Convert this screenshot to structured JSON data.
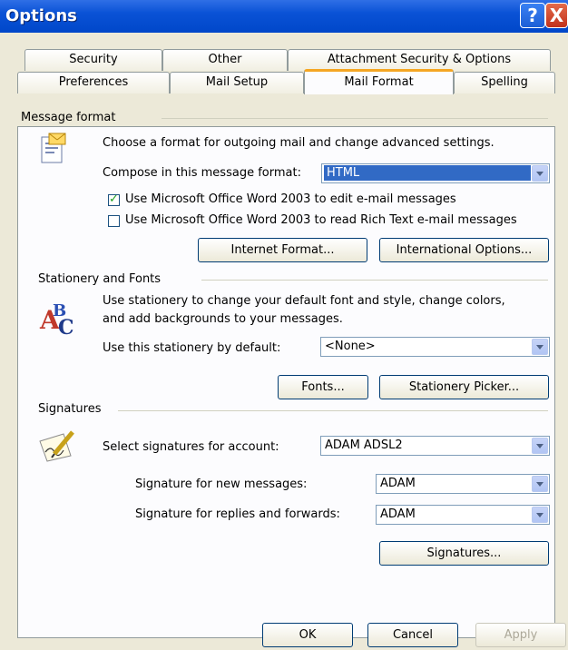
{
  "window": {
    "title": "Options",
    "help_glyph": "?",
    "close_glyph": "X"
  },
  "tabs_row1": [
    "Security",
    "Other",
    "Attachment Security & Options"
  ],
  "tabs_row2": [
    "Preferences",
    "Mail Setup",
    "Mail Format",
    "Spelling"
  ],
  "active_tab": "Mail Format",
  "message_format": {
    "heading": "Message format",
    "description": "Choose a format for outgoing mail and change advanced settings.",
    "compose_label": "Compose in this message format:",
    "compose_value": "HTML",
    "use_word_edit": "Use Microsoft Office Word 2003 to edit e-mail messages",
    "use_word_edit_checked": true,
    "use_word_read": "Use Microsoft Office Word 2003 to read Rich Text e-mail messages",
    "use_word_read_checked": false,
    "internet_format_button": "Internet Format...",
    "international_options_button": "International Options..."
  },
  "stationery": {
    "heading": "Stationery and Fonts",
    "description_line1": "Use stationery to change your default font and style, change colors,",
    "description_line2": "and add backgrounds to your messages.",
    "default_label": "Use this stationery by default:",
    "default_value": "<None>",
    "fonts_button": "Fonts...",
    "picker_button": "Stationery Picker..."
  },
  "signatures": {
    "heading": "Signatures",
    "account_label": "Select signatures for account:",
    "account_value": "ADAM ADSL2",
    "new_label": "Signature for new messages:",
    "new_value": "ADAM",
    "replies_label": "Signature for replies and forwards:",
    "replies_value": "ADAM",
    "signatures_button": "Signatures..."
  },
  "footer": {
    "ok": "OK",
    "cancel": "Cancel",
    "apply": "Apply"
  }
}
